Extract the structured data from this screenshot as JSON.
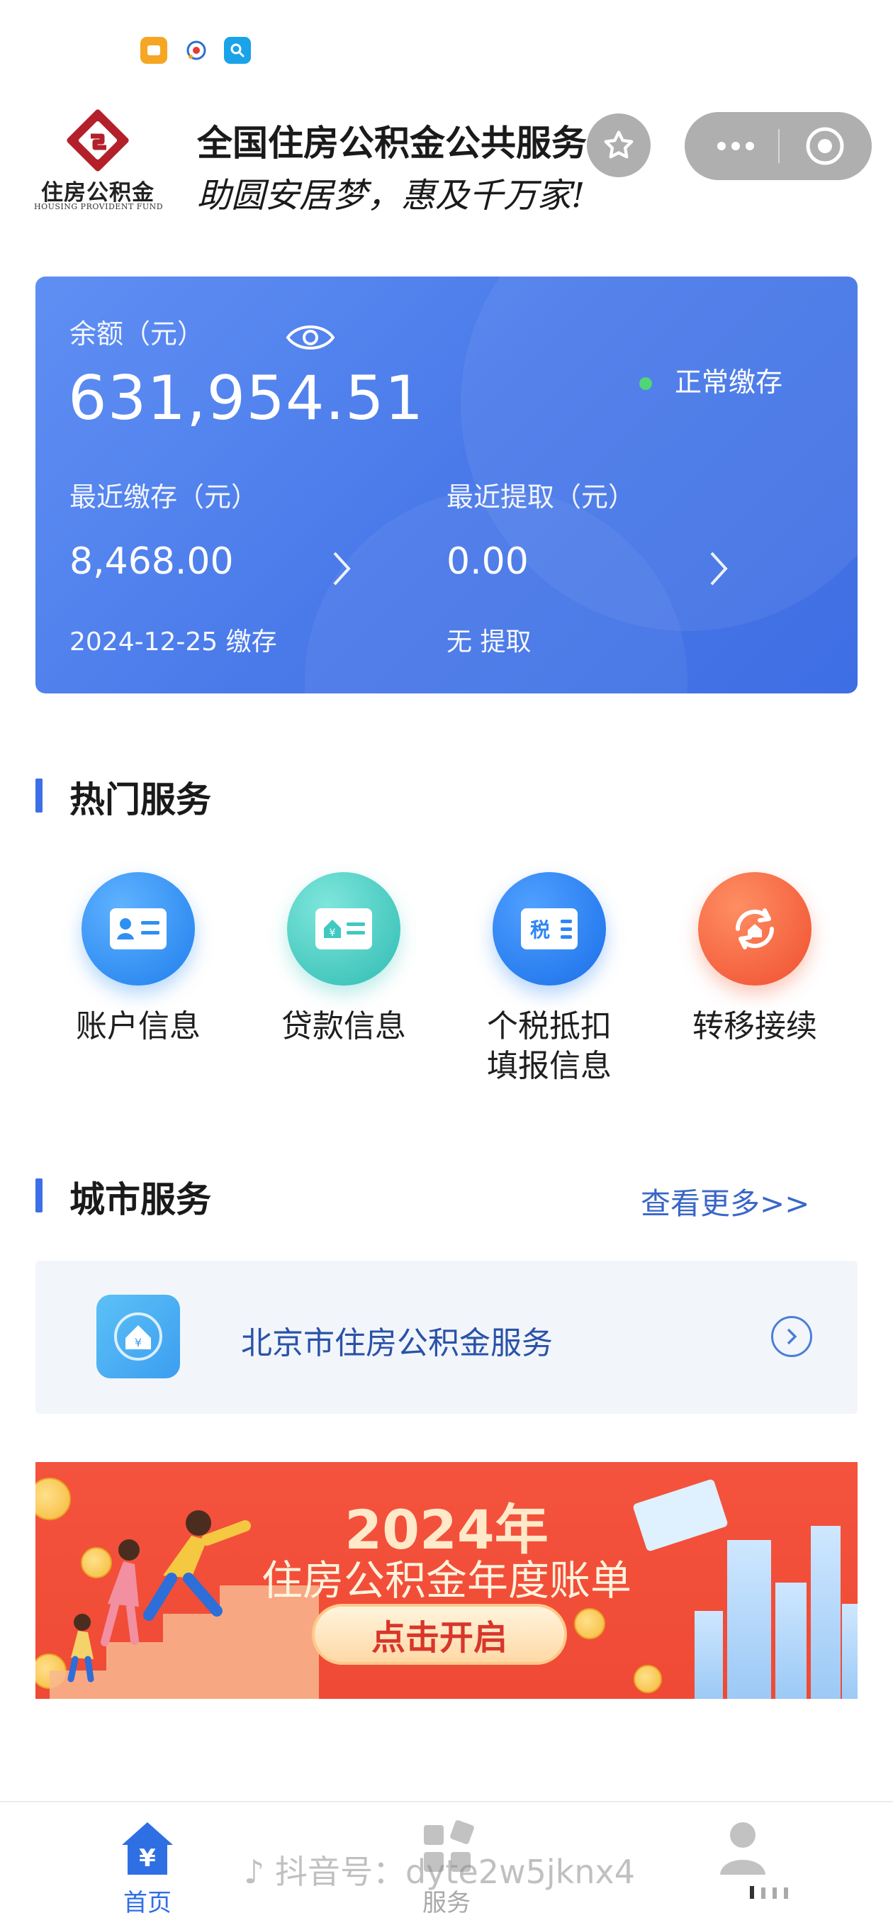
{
  "header": {
    "logo_text_cn": "住房公积金",
    "logo_text_en": "HOUSING PROVIDENT FUND",
    "title": "全国住房公积金公共服务",
    "subtitle": "助圆安居梦，惠及千万家!"
  },
  "balance_card": {
    "balance_label": "余额（元）",
    "balance_value": "631,954.51",
    "status_text": "正常缴存",
    "recent_deposit_label": "最近缴存（元）",
    "recent_deposit_value": "8,468.00",
    "recent_deposit_note": "2024-12-25 缴存",
    "recent_withdraw_label": "最近提取（元）",
    "recent_withdraw_value": "0.00",
    "recent_withdraw_note": "无 提取"
  },
  "hot_services": {
    "title": "热门服务",
    "items": [
      {
        "label": "账户信息",
        "icon": "account-card-icon",
        "color": "#2f8ff2"
      },
      {
        "label": "贷款信息",
        "icon": "loan-card-icon",
        "color": "#3fc9c0"
      },
      {
        "label": "个税抵扣\n填报信息",
        "icon": "tax-icon",
        "color": "#2f86f4",
        "badge": "税"
      },
      {
        "label": "转移接续",
        "icon": "transfer-icon",
        "color": "#f2643c"
      }
    ]
  },
  "city_services": {
    "title": "城市服务",
    "more_label": "查看更多>>",
    "item_label": "北京市住房公积金服务"
  },
  "banner": {
    "year": "2024年",
    "title": "住房公积金年度账单",
    "button_label": "点击开启"
  },
  "bottom_nav": {
    "items": [
      {
        "label": "首页",
        "active": true
      },
      {
        "label": "服务",
        "active": false
      },
      {
        "label": "",
        "active": false
      }
    ]
  },
  "watermark": "抖音号：dyte2w5jknx4",
  "colors": {
    "accent": "#3d6fe6",
    "card_blue": "#4a7ae9",
    "status_green": "#4fd678",
    "banner_red": "#f2503a",
    "link_blue": "#3a66c8"
  }
}
